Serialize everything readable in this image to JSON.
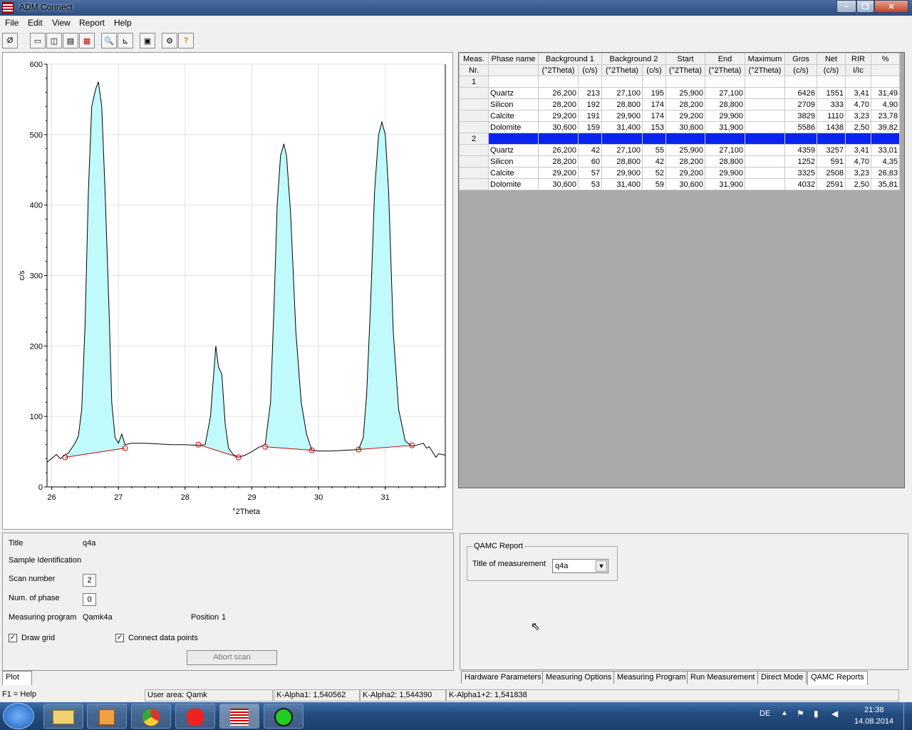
{
  "window": {
    "title": "ADM Connect"
  },
  "menu": [
    "File",
    "Edit",
    "View",
    "Report",
    "Help"
  ],
  "toolbar_icons": [
    "disconnect-icon",
    "window-a-icon",
    "window-b-icon",
    "window-c-icon",
    "window-d-icon",
    "zoom-icon",
    "axis-icon",
    "clipboard-icon",
    "settings-icon",
    "help-icon"
  ],
  "chart_data": {
    "type": "area",
    "xlabel": "°2Theta",
    "ylabel": "c/s",
    "xlim": [
      25.93,
      31.9
    ],
    "ylim": [
      0,
      600
    ],
    "x_ticks": [
      "26",
      "27",
      "28",
      "29",
      "30",
      "31"
    ],
    "y_ticks": [
      "0",
      "100",
      "200",
      "300",
      "400",
      "500",
      "600"
    ],
    "grid": true,
    "profile": [
      [
        25.93,
        35
      ],
      [
        26.02,
        42
      ],
      [
        26.07,
        46
      ],
      [
        26.13,
        40
      ],
      [
        26.18,
        44
      ],
      [
        26.25,
        48
      ],
      [
        26.3,
        55
      ],
      [
        26.35,
        62
      ],
      [
        26.4,
        72
      ],
      [
        26.45,
        110
      ],
      [
        26.5,
        230
      ],
      [
        26.55,
        420
      ],
      [
        26.6,
        540
      ],
      [
        26.66,
        565
      ],
      [
        26.7,
        575
      ],
      [
        26.75,
        540
      ],
      [
        26.8,
        420
      ],
      [
        26.86,
        250
      ],
      [
        26.9,
        120
      ],
      [
        26.95,
        70
      ],
      [
        27.0,
        62
      ],
      [
        27.05,
        75
      ],
      [
        27.1,
        60
      ],
      [
        27.2,
        62
      ],
      [
        27.4,
        62
      ],
      [
        27.6,
        61
      ],
      [
        27.8,
        60
      ],
      [
        28.0,
        60
      ],
      [
        28.2,
        59
      ],
      [
        28.3,
        60
      ],
      [
        28.38,
        100
      ],
      [
        28.42,
        150
      ],
      [
        28.46,
        200
      ],
      [
        28.5,
        170
      ],
      [
        28.55,
        160
      ],
      [
        28.6,
        90
      ],
      [
        28.65,
        55
      ],
      [
        28.72,
        46
      ],
      [
        28.8,
        42
      ],
      [
        28.9,
        45
      ],
      [
        29.0,
        50
      ],
      [
        29.1,
        56
      ],
      [
        29.2,
        60
      ],
      [
        29.28,
        120
      ],
      [
        29.33,
        250
      ],
      [
        29.38,
        400
      ],
      [
        29.43,
        470
      ],
      [
        29.48,
        487
      ],
      [
        29.52,
        470
      ],
      [
        29.58,
        390
      ],
      [
        29.66,
        220
      ],
      [
        29.74,
        120
      ],
      [
        29.82,
        75
      ],
      [
        29.9,
        52
      ],
      [
        30.0,
        51
      ],
      [
        30.2,
        51
      ],
      [
        30.4,
        52
      ],
      [
        30.6,
        53
      ],
      [
        30.67,
        70
      ],
      [
        30.72,
        130
      ],
      [
        30.78,
        260
      ],
      [
        30.84,
        420
      ],
      [
        30.9,
        500
      ],
      [
        30.95,
        518
      ],
      [
        31.0,
        500
      ],
      [
        31.05,
        420
      ],
      [
        31.12,
        220
      ],
      [
        31.2,
        110
      ],
      [
        31.3,
        65
      ],
      [
        31.4,
        58
      ],
      [
        31.5,
        60
      ],
      [
        31.57,
        62
      ],
      [
        31.62,
        55
      ],
      [
        31.66,
        57
      ],
      [
        31.72,
        48
      ],
      [
        31.76,
        42
      ],
      [
        31.8,
        47
      ],
      [
        31.9,
        45
      ]
    ],
    "baselines": [
      {
        "x": [
          26.2,
          27.1
        ],
        "y": [
          42,
          55
        ]
      },
      {
        "x": [
          28.2,
          28.8
        ],
        "y": [
          60,
          42
        ]
      },
      {
        "x": [
          29.2,
          29.9
        ],
        "y": [
          57,
          52
        ]
      },
      {
        "x": [
          30.6,
          31.4
        ],
        "y": [
          53,
          59
        ]
      }
    ]
  },
  "table": {
    "header1": [
      "Meas.",
      "Phase name",
      "Background  1",
      "",
      "Background  2",
      "",
      "Start",
      "End",
      "Maximum",
      "Gros",
      "Net",
      "RIR",
      "%"
    ],
    "header2": [
      "Nr.",
      "",
      "(°2Theta)",
      "(c/s)",
      "(°2Theta)",
      "(c/s)",
      "(°2Theta)",
      "(°2Theta)",
      "(°2Theta)",
      "(c/s)",
      "(c/s)",
      "I/Ic",
      ""
    ],
    "groups": [
      {
        "nr": "1",
        "rows": [
          [
            "Quartz",
            "26,200",
            "213",
            "27,100",
            "195",
            "25,900",
            "27,100",
            "",
            "6426",
            "1551",
            "3,41",
            "31,49"
          ],
          [
            "Silicon",
            "28,200",
            "192",
            "28,800",
            "174",
            "28,200",
            "28,800",
            "",
            "2709",
            "333",
            "4,70",
            "4,90"
          ],
          [
            "Calcite",
            "29,200",
            "191",
            "29,900",
            "174",
            "29,200",
            "29,900",
            "",
            "3829",
            "1110",
            "3,23",
            "23,78"
          ],
          [
            "Dolomite",
            "30,600",
            "159",
            "31,400",
            "153",
            "30,600",
            "31,900",
            "",
            "5586",
            "1438",
            "2,50",
            "39,82"
          ]
        ]
      },
      {
        "nr": "2",
        "rows": [
          [
            "Quartz",
            "26,200",
            "42",
            "27,100",
            "55",
            "25,900",
            "27,100",
            "",
            "4359",
            "3257",
            "3,41",
            "33,01"
          ],
          [
            "Silicon",
            "28,200",
            "60",
            "28,800",
            "42",
            "28,200",
            "28,800",
            "",
            "1252",
            "591",
            "4,70",
            "4,35"
          ],
          [
            "Calcite",
            "29,200",
            "57",
            "29,900",
            "52",
            "29,200",
            "29,900",
            "",
            "3325",
            "2508",
            "3,23",
            "26,83"
          ],
          [
            "Dolomite",
            "30,600",
            "53",
            "31,400",
            "59",
            "30,600",
            "31,900",
            "",
            "4032",
            "2591",
            "2,50",
            "35,81"
          ]
        ]
      }
    ]
  },
  "info": {
    "title_label": "Title",
    "title_value": "q4a",
    "sample_label": "Sample Identification",
    "scan_label": "Scan number",
    "scan_value": "2",
    "phase_label": "Num. of phase",
    "phase_value": "0",
    "program_label": "Measuring program",
    "program_value": "Qamk4a",
    "position_label": "Position",
    "position_value": "1",
    "draw_grid": "Draw grid",
    "connect": "Connect data points",
    "abort": "Abort scan"
  },
  "left_tab": "Plot",
  "qamc": {
    "group": "QAMC Report",
    "label": "Title of measurement",
    "value": "q4a"
  },
  "tabs": [
    "Hardware Parameters",
    "Measuring Options",
    "Measuring Program",
    "Run Measurement",
    "Direct Mode",
    "QAMC Reports"
  ],
  "status": [
    "F1 = Help",
    "User area: Qamk",
    "K-Alpha1: 1,540562",
    "K-Alpha2: 1,544390",
    "K-Alpha1+2: 1,541838"
  ],
  "tray": {
    "lang": "DE",
    "time": "21:38",
    "date": "14.08.2014"
  },
  "colors": {
    "fill": "#c0fafa",
    "baseline": "#cc0000",
    "selection": "#0a24f0"
  }
}
